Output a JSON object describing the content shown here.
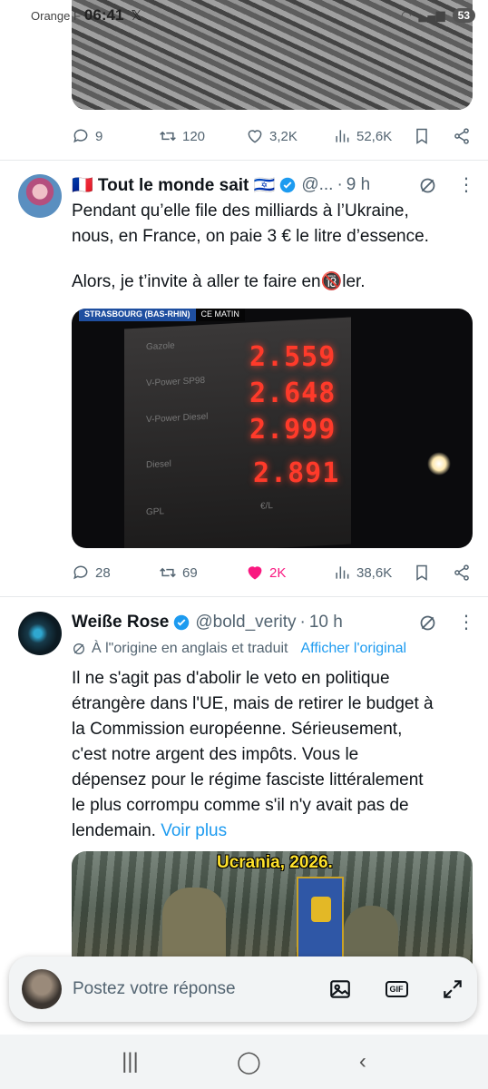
{
  "status_bar": {
    "carrier": "Orange F",
    "time": "06:41",
    "app_icon": "x-logo-icon",
    "battery": "53"
  },
  "tweets": [
    {
      "stats": {
        "replies": "9",
        "retweets": "120",
        "likes": "3,2K",
        "views": "52,6K"
      }
    },
    {
      "name": "🇫🇷 Tout le monde sait 🇮🇱",
      "handle": "@...",
      "time": "9 h",
      "text_line1": "Pendant qu’elle file des milliards à l’Ukraine,",
      "text_line2": "nous, en France, on paie 3 € le litre d’essence.",
      "text_line3": "Alors, je t’invite à aller te faire en🔞ler.",
      "image": {
        "banner_location": "STRASBOURG (BAS-RHIN)",
        "banner_time": "CE MATIN",
        "prices": [
          "2.559",
          "2.648",
          "2.999",
          "2.891"
        ],
        "board_labels": [
          "Gazole",
          "V-Power SP98",
          "V-Power Diesel",
          "Diesel",
          "GPL",
          "€/L"
        ]
      },
      "stats": {
        "replies": "28",
        "retweets": "69",
        "likes": "2K",
        "views": "38,6K",
        "liked": true
      }
    },
    {
      "name": "Weiße Rose",
      "handle": "@bold_verity",
      "time": "10 h",
      "translation_note": "À l\"origine en anglais et traduit",
      "translation_link": "Afficher l'original",
      "text_lines": [
        "Il ne s'agit pas d'abolir le veto en politique",
        "étrangère dans l'UE, mais de retirer le budget à",
        "la Commission européenne. Sérieusement,",
        "c'est notre argent des impôts. Vous le",
        "dépensez pour le régime fasciste littéralement",
        "le plus corrompu comme s'il n'y avait pas de",
        "lendemain."
      ],
      "more_link": "Voir plus",
      "image_caption": "Ucrania, 2026."
    }
  ],
  "composer": {
    "placeholder": "Postez votre réponse"
  },
  "colors": {
    "accent": "#1d9bf0",
    "like": "#f91880",
    "muted": "#536471"
  }
}
